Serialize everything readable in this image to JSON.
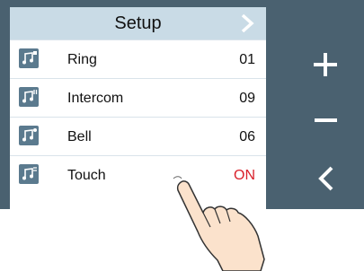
{
  "header": {
    "title": "Setup",
    "next_icon": "chevron-right-icon"
  },
  "rows": [
    {
      "label": "Ring",
      "value": "01",
      "icon": "music-note-icon"
    },
    {
      "label": "Intercom",
      "value": "09",
      "icon": "music-note-icon"
    },
    {
      "label": "Bell",
      "value": "06",
      "icon": "music-note-icon"
    },
    {
      "label": "Touch",
      "value": "ON",
      "icon": "music-note-icon"
    }
  ],
  "side_buttons": [
    "plus-icon",
    "minus-icon",
    "chevron-left-icon"
  ],
  "colors": {
    "frame": "#4a6170",
    "header_bg": "#c9dbe6",
    "on_value": "#d9202a"
  }
}
